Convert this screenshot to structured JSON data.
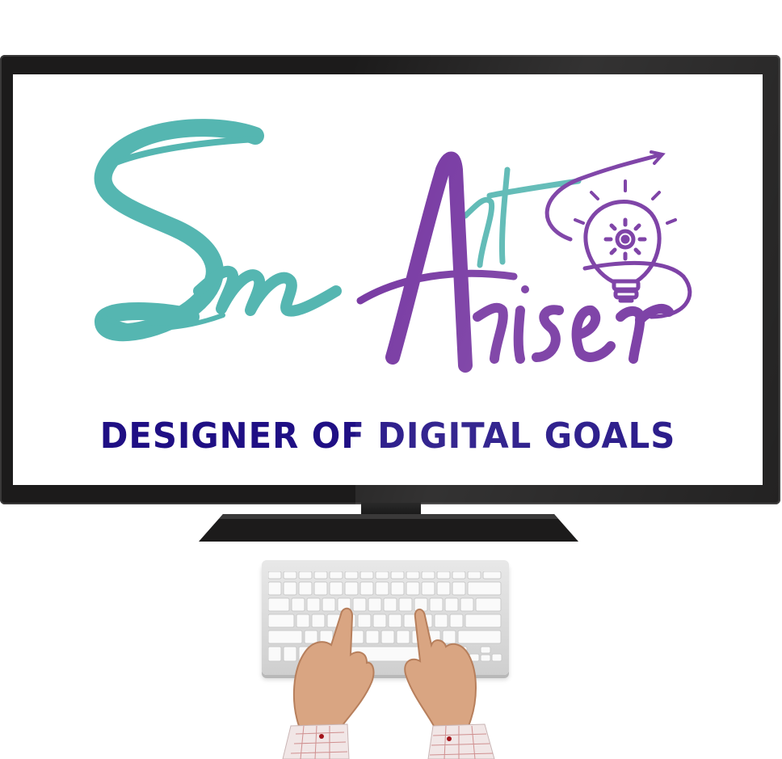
{
  "logo": {
    "script_word_left": "Sm",
    "script_word_top": "Art",
    "script_word_bottom": "Ariser",
    "tagline": "DESIGNER OF DIGITAL GOALS",
    "icon": "lightbulb-gear-icon",
    "colors": {
      "teal": "#55b6b1",
      "purple": "#7434a0",
      "navy": "#1f0f84"
    }
  },
  "device": {
    "monitor_color": "#1c1b1b",
    "keyboard_color": "#e2e2e2"
  }
}
